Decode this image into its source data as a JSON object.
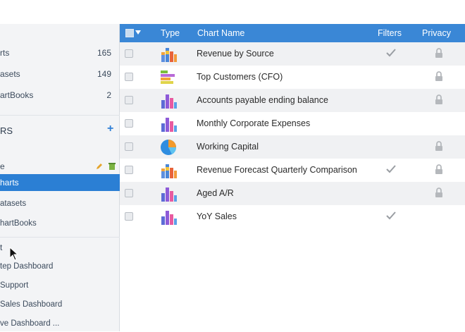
{
  "sidebar": {
    "counts": [
      {
        "label": "rts",
        "count": "165"
      },
      {
        "label": "asets",
        "count": "149"
      },
      {
        "label": "artBooks",
        "count": "2"
      }
    ],
    "section_heading": "RS",
    "folder_label": "e",
    "selected_label": "harts",
    "sub_items": [
      "atasets",
      "hartBooks"
    ],
    "group_label": "t",
    "dashboards": [
      "tep Dashboard",
      "Support",
      "Sales Dashboard",
      "ve Dashboard ..."
    ]
  },
  "table": {
    "headers": {
      "type": "Type",
      "name": "Chart Name",
      "filters": "Filters",
      "privacy": "Privacy"
    },
    "rows": [
      {
        "name": "Revenue by Source",
        "icon": "column-chart-icon",
        "filters": true,
        "privacy": true
      },
      {
        "name": "Top Customers (CFO)",
        "icon": "bar-chart-icon",
        "filters": false,
        "privacy": true
      },
      {
        "name": "Accounts payable ending balance",
        "icon": "column-chart-icon",
        "filters": false,
        "privacy": true
      },
      {
        "name": "Monthly Corporate Expenses",
        "icon": "column-chart-icon",
        "filters": false,
        "privacy": false
      },
      {
        "name": "Working Capital",
        "icon": "pie-chart-icon",
        "filters": false,
        "privacy": true
      },
      {
        "name": "Revenue Forecast Quarterly Comparison",
        "icon": "column-chart-icon",
        "filters": true,
        "privacy": true
      },
      {
        "name": "Aged A/R",
        "icon": "column-chart-icon",
        "filters": false,
        "privacy": true
      },
      {
        "name": "YoY Sales",
        "icon": "column-chart-icon",
        "filters": true,
        "privacy": false
      }
    ]
  },
  "colors": {
    "accent": "#2b7fd4",
    "header": "#3a87d6"
  }
}
